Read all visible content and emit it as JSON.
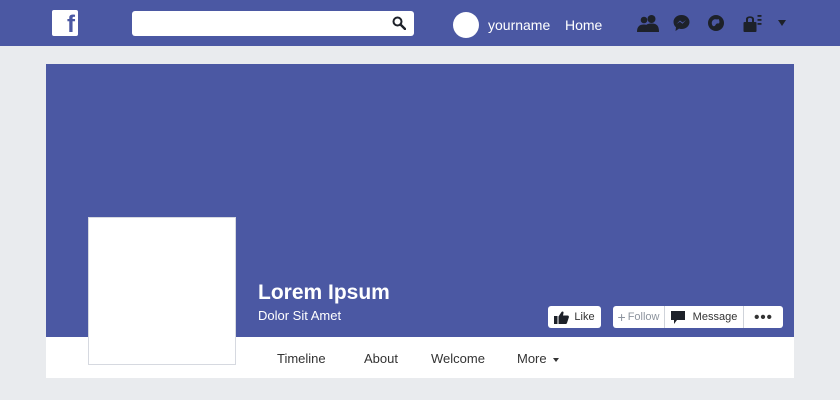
{
  "header": {
    "logo_letter": "f",
    "search": {
      "placeholder": ""
    },
    "username": "yourname",
    "home_label": "Home",
    "icons": [
      "friends-icon",
      "messages-icon",
      "notifications-icon",
      "privacy-icon",
      "dropdown-icon"
    ]
  },
  "profile": {
    "name": "Lorem Ipsum",
    "subtitle": "Dolor Sit Amet"
  },
  "actions": {
    "like_label": "Like",
    "follow_label": "Follow",
    "message_label": "Message",
    "more_label": "•••"
  },
  "tabs": [
    "Timeline",
    "About",
    "Welcome",
    "More"
  ],
  "colors": {
    "brand": "#4b58a3",
    "page_bg": "#e9ebee",
    "icon_dark": "#1d2129"
  }
}
